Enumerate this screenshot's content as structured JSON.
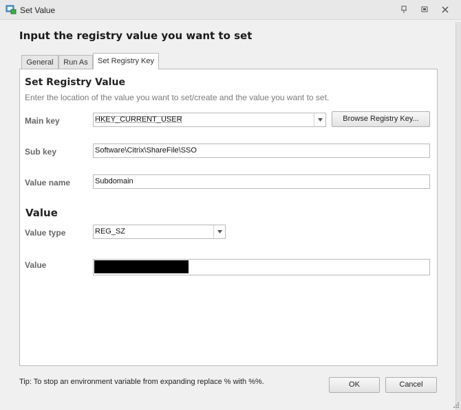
{
  "window": {
    "title": "Set Value",
    "icon": "registry-set-icon",
    "controls": [
      "pin-icon",
      "restore-icon",
      "close-icon"
    ]
  },
  "header": {
    "title": "Input the registry value you want to set"
  },
  "tabs": [
    {
      "label": "General",
      "active": false
    },
    {
      "label": "Run As",
      "active": false
    },
    {
      "label": "Set Registry Key",
      "active": true
    }
  ],
  "registry": {
    "section_title": "Set Registry Value",
    "description": "Enter the location of the value you want to set/create and the value you want to set.",
    "main_key": {
      "label": "Main key",
      "value": "HKEY_CURRENT_USER"
    },
    "browse_button": "Browse Registry Key...",
    "sub_key": {
      "label": "Sub key",
      "value": "Software\\Citrix\\ShareFile\\SSO"
    },
    "value_name": {
      "label": "Value name",
      "value": "Subdomain"
    }
  },
  "value_section": {
    "title": "Value",
    "value_type": {
      "label": "Value type",
      "value": "REG_SZ"
    },
    "value": {
      "label": "Value",
      "redacted": true
    }
  },
  "footer": {
    "tip": "Tip: To stop an environment variable from expanding replace % with %%.",
    "ok_label": "OK",
    "cancel_label": "Cancel"
  }
}
